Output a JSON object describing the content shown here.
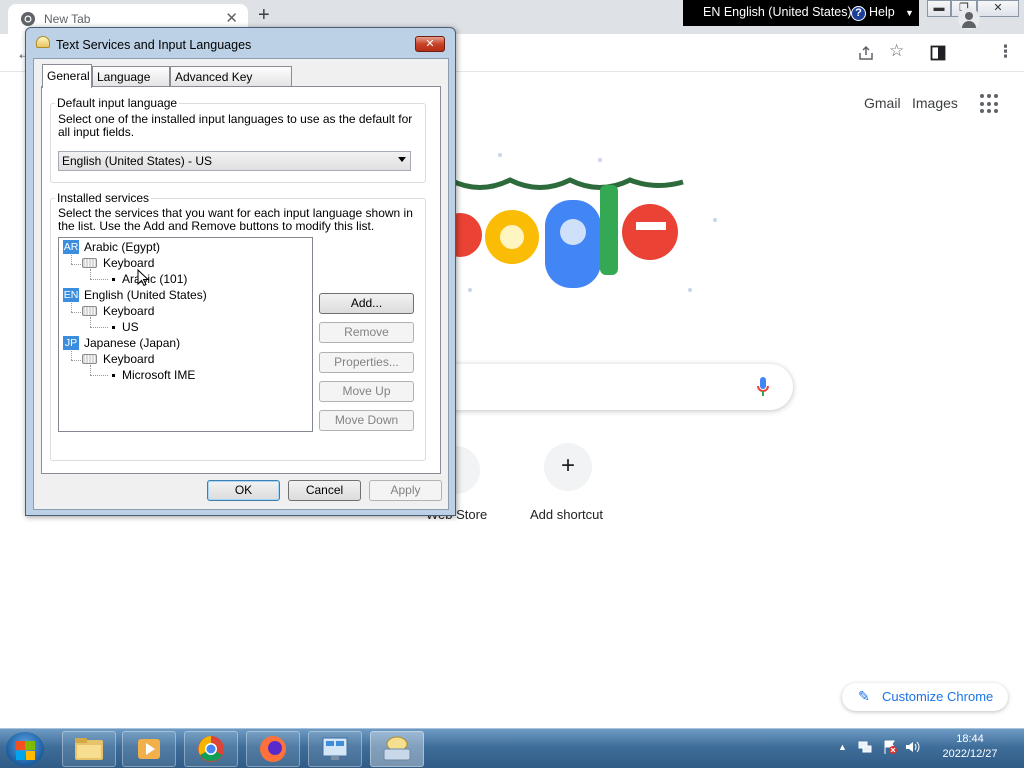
{
  "chrome": {
    "tab_title": "New Tab",
    "tab_close": "✕",
    "new_tab": "+",
    "language_bar": {
      "language": "EN English (United States)",
      "help": "Help"
    },
    "header_links": {
      "gmail": "Gmail",
      "images": "Images"
    },
    "shortcuts": [
      {
        "label": "Web Store"
      },
      {
        "label": "Add shortcut",
        "icon": "+"
      }
    ],
    "customize": "Customize Chrome"
  },
  "dialog": {
    "title": "Text Services and Input Languages",
    "tabs": [
      "General",
      "Language Bar",
      "Advanced Key Settings"
    ],
    "default_input": {
      "group_title": "Default input language",
      "description": "Select one of the installed input languages to use as the default for all input fields.",
      "selected": "English (United States) - US"
    },
    "installed": {
      "group_title": "Installed services",
      "description": "Select the services that you want for each input language shown in the list. Use the Add and Remove buttons to modify this list.",
      "tree": [
        {
          "badge": "AR",
          "language": "Arabic (Egypt)",
          "category": "Keyboard",
          "layout": "Arabic (101)"
        },
        {
          "badge": "EN",
          "language": "English (United States)",
          "category": "Keyboard",
          "layout": "US"
        },
        {
          "badge": "JP",
          "language": "Japanese (Japan)",
          "category": "Keyboard",
          "layout": "Microsoft IME"
        }
      ],
      "buttons": {
        "add": "Add...",
        "remove": "Remove",
        "properties": "Properties...",
        "move_up": "Move Up",
        "move_down": "Move Down"
      }
    },
    "footer": {
      "ok": "OK",
      "cancel": "Cancel",
      "apply": "Apply"
    }
  },
  "taskbar": {
    "time": "18:44",
    "date": "2022/12/27"
  }
}
